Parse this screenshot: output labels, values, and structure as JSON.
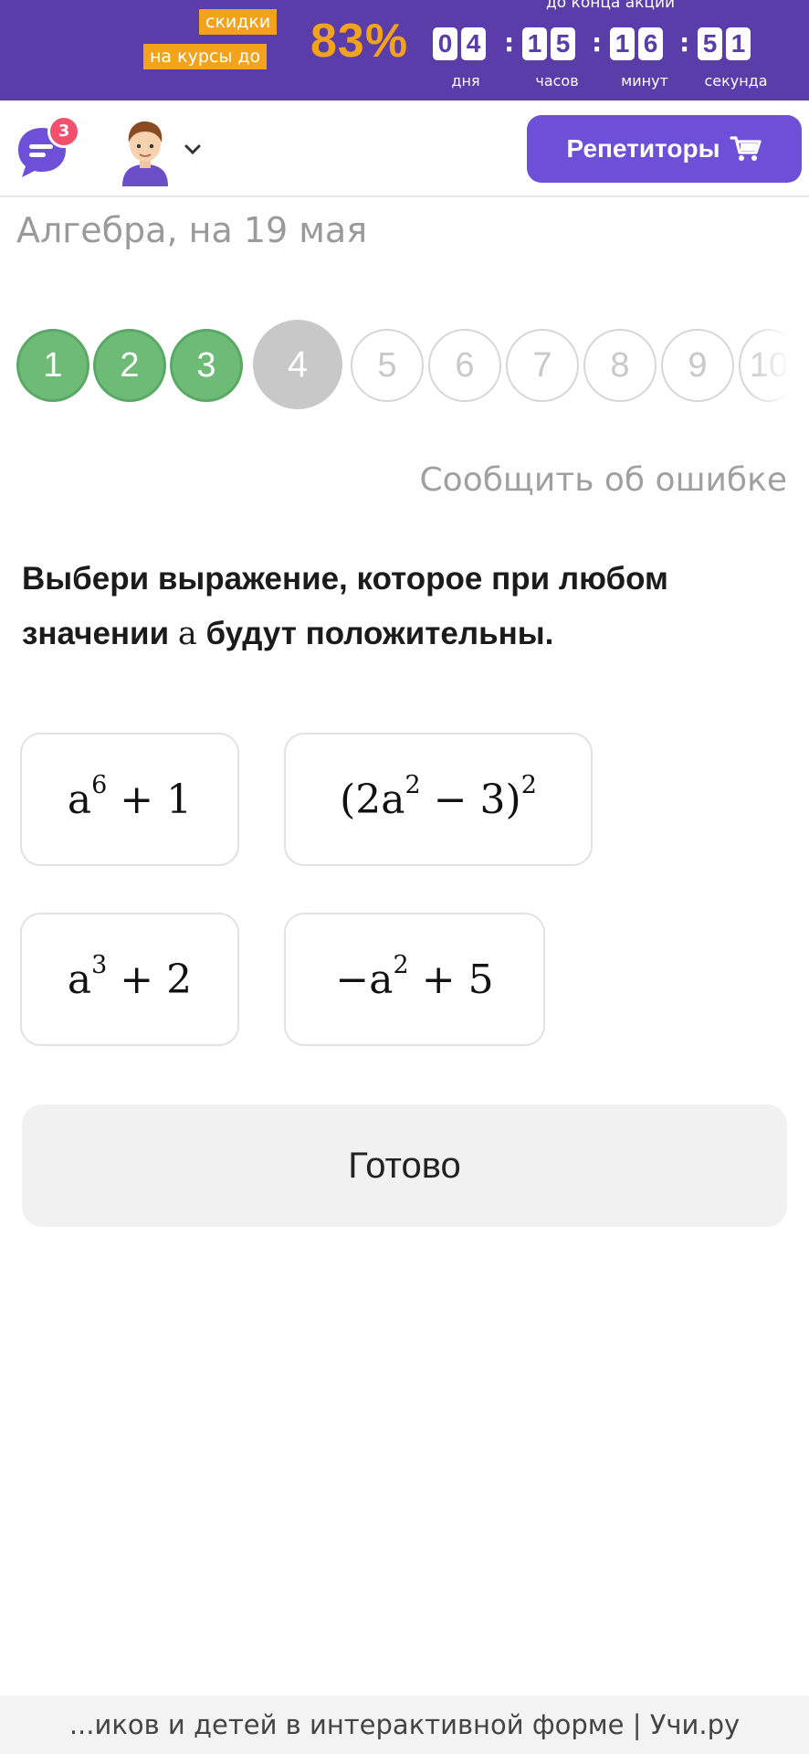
{
  "promo": {
    "tag_line1": "скидки",
    "tag_line2": "на курсы до",
    "percent": "83%",
    "until_label": "до конца акции",
    "countdown": {
      "days": [
        "0",
        "4"
      ],
      "hours": [
        "1",
        "5"
      ],
      "minutes": [
        "1",
        "6"
      ],
      "seconds": [
        "5",
        "1"
      ]
    },
    "unit_labels": {
      "days": "дня",
      "hours": "часов",
      "minutes": "минут",
      "seconds": "секунда"
    },
    "colors": {
      "background": "#5a3da8",
      "accent": "#f2a21b"
    }
  },
  "header": {
    "chat_badge_count": "3",
    "tutors_button_label": "Репетиторы",
    "icons": [
      "chat-icon",
      "avatar",
      "chevron-down-icon",
      "cart-icon"
    ],
    "accent_color": "#6d4fd8"
  },
  "lesson": {
    "subject_date": "Алгебра, на 19 мая",
    "steps": [
      {
        "label": "1",
        "state": "done"
      },
      {
        "label": "2",
        "state": "done"
      },
      {
        "label": "3",
        "state": "done"
      },
      {
        "label": "4",
        "state": "current"
      },
      {
        "label": "5",
        "state": "todo"
      },
      {
        "label": "6",
        "state": "todo"
      },
      {
        "label": "7",
        "state": "todo"
      },
      {
        "label": "8",
        "state": "todo"
      },
      {
        "label": "9",
        "state": "todo"
      },
      {
        "label": "10",
        "state": "todo"
      }
    ],
    "report_error_link": "Сообщить об ошибке"
  },
  "task": {
    "question_part1": "Выбери выражение, которое при любом значении",
    "question_variable": "a",
    "question_part2": "будут положительны.",
    "options": [
      {
        "base": "a",
        "exp": "6",
        "rest": "+ 1"
      },
      {
        "prefix": "(2a",
        "exp": "2",
        "middle": "− 3)",
        "exp2": "2"
      },
      {
        "base": "a",
        "exp": "3",
        "rest": "+ 2"
      },
      {
        "base": "−a",
        "exp": "2",
        "rest": "+ 5"
      }
    ],
    "done_button": "Готово"
  },
  "footer": {
    "text": "...иков и детей в интерактивной форме | Учи.ру"
  }
}
